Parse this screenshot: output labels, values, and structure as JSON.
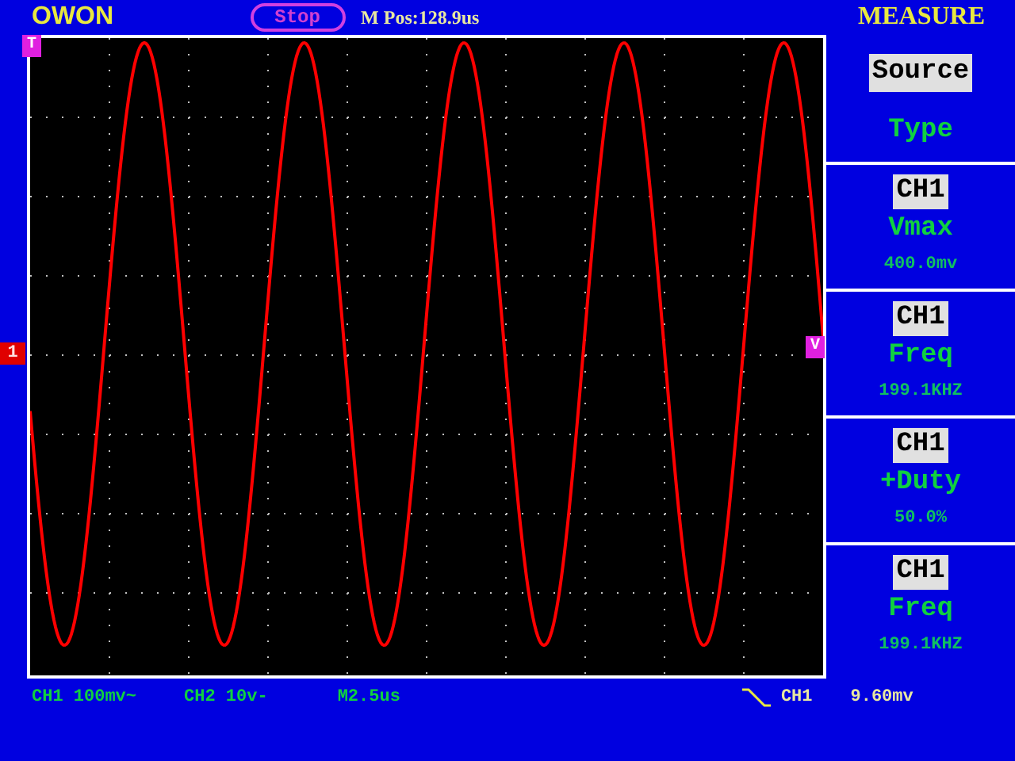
{
  "header": {
    "brand": "OWON",
    "run_state": "Stop",
    "position": "M Pos:128.9us"
  },
  "markers": {
    "trigger_position": "T",
    "channel_1": "1",
    "trigger_level": "V"
  },
  "measure": {
    "title": "MEASURE",
    "source_label": "Source",
    "type_label": "Type",
    "items": [
      {
        "channel": "CH1",
        "type": "Vmax",
        "value": "400.0mv"
      },
      {
        "channel": "CH1",
        "type": "Freq",
        "value": "199.1KHZ"
      },
      {
        "channel": "CH1",
        "type": "+Duty",
        "value": "50.0%"
      },
      {
        "channel": "CH1",
        "type": "Freq",
        "value": "199.1KHZ"
      }
    ]
  },
  "status_bar": {
    "ch1": "CH1 100mv~",
    "ch2": "CH2 10v-",
    "timebase": "M2.5us",
    "trigger_source": "CH1",
    "trigger_level": "9.60mv"
  }
}
